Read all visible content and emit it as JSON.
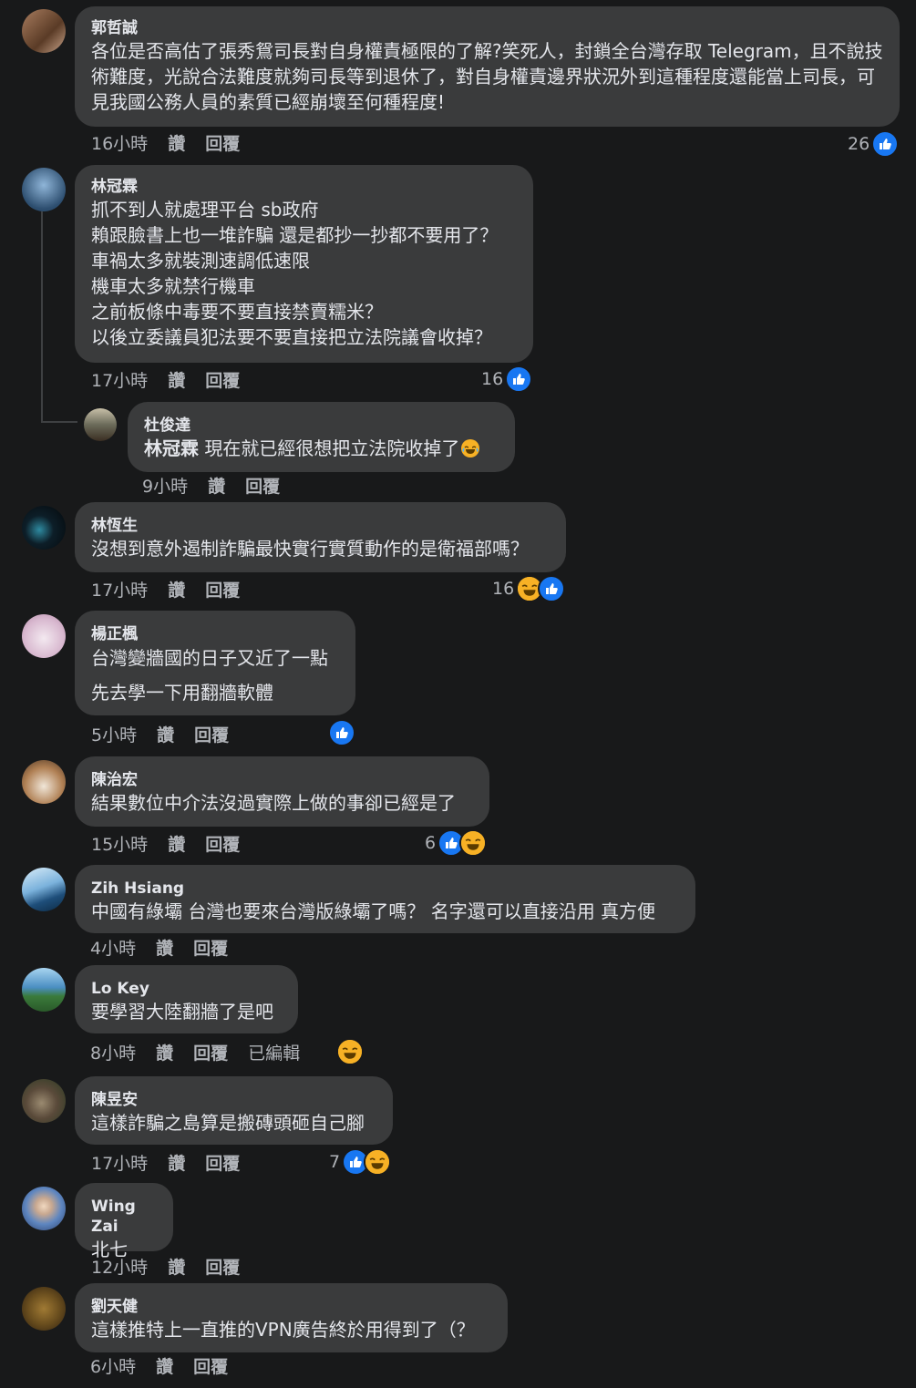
{
  "comments": [
    {
      "name": "郭哲誠",
      "text": "各位是否高估了張秀鴛司長對自身權責極限的了解?笑死人，封鎖全台灣存取 Telegram，且不說技術難度，光說合法難度就夠司長等到退休了，對自身權責邊界狀況外到這種程度還能當上司長，可見我國公務人員的素質已經崩壞至何種程度!",
      "time": "16小時",
      "like": "讚",
      "reply": "回覆",
      "reaction_count": "26",
      "reactions": [
        "like"
      ],
      "avatar_color": "#7a5a42"
    },
    {
      "name": "林冠霖",
      "text": "抓不到人就處理平台 sb政府\n賴跟臉書上也一堆詐騙 還是都抄一抄都不要用了？\n車禍太多就裝測速調低速限\n機車太多就禁行機車\n之前板條中毒要不要直接禁賣糯米？\n以後立委議員犯法要不要直接把立法院議會收掉？",
      "time": "17小時",
      "like": "讚",
      "reply": "回覆",
      "reaction_count": "16",
      "reactions": [
        "like"
      ],
      "avatar_color": "#2c4d6e"
    },
    {
      "name": "杜俊達",
      "mention": "林冠霖",
      "text": " 現在就已經很想把立法院收掉了",
      "time": "9小時",
      "like": "讚",
      "reply": "回覆",
      "avatar_color": "#6b6b5a"
    },
    {
      "name": "林恆生",
      "text": "沒想到意外遏制詐騙最快實行實質動作的是衛福部嗎？",
      "time": "17小時",
      "like": "讚",
      "reply": "回覆",
      "reaction_count": "16",
      "reactions": [
        "haha",
        "like"
      ],
      "avatar_color": "#0d1e28"
    },
    {
      "name": "楊正楓",
      "text": "台灣變牆國的日子又近了一點\n先去學一下用翻牆軟體",
      "time": "5小時",
      "like": "讚",
      "reply": "回覆",
      "reaction_count": "",
      "reactions": [
        "like"
      ],
      "avatar_color": "#d8b8cf"
    },
    {
      "name": "陳治宏",
      "text": "結果數位中介法沒過實際上做的事卻已經是了",
      "time": "15小時",
      "like": "讚",
      "reply": "回覆",
      "reaction_count": "6",
      "reactions": [
        "like",
        "haha"
      ],
      "avatar_color": "#b08054"
    },
    {
      "name": "Zih Hsiang",
      "text": "中國有綠壩 台灣也要來台灣版綠壩了嗎？ 名字還可以直接沿用 真方便",
      "time": "4小時",
      "like": "讚",
      "reply": "回覆",
      "avatar_color": "#3f78a8"
    },
    {
      "name": "Lo Key",
      "text": "要學習大陸翻牆了是吧",
      "time": "8小時",
      "like": "讚",
      "reply": "回覆",
      "edited": "已編輯",
      "reaction_count": "",
      "reactions": [
        "haha"
      ],
      "avatar_color": "#4a8ec2"
    },
    {
      "name": "陳昱安",
      "text": "這樣詐騙之島算是搬磚頭砸自己腳",
      "time": "17小時",
      "like": "讚",
      "reply": "回覆",
      "reaction_count": "7",
      "reactions": [
        "like",
        "haha"
      ],
      "avatar_color": "#5a4a3a"
    },
    {
      "name": "Wing Zai",
      "text": "北七",
      "time": "12小時",
      "like": "讚",
      "reply": "回覆",
      "avatar_color": "#5e86c0"
    },
    {
      "name": "劉天健",
      "text": "這樣推特上一直推的VPN廣告終於用得到了（？",
      "time": "6小時",
      "like": "讚",
      "reply": "回覆",
      "avatar_color": "#6a4e1e"
    }
  ],
  "colors": {
    "background": "#18191a",
    "bubble": "#3a3b3c",
    "like": "#1877f2",
    "haha": "#f7b125"
  }
}
